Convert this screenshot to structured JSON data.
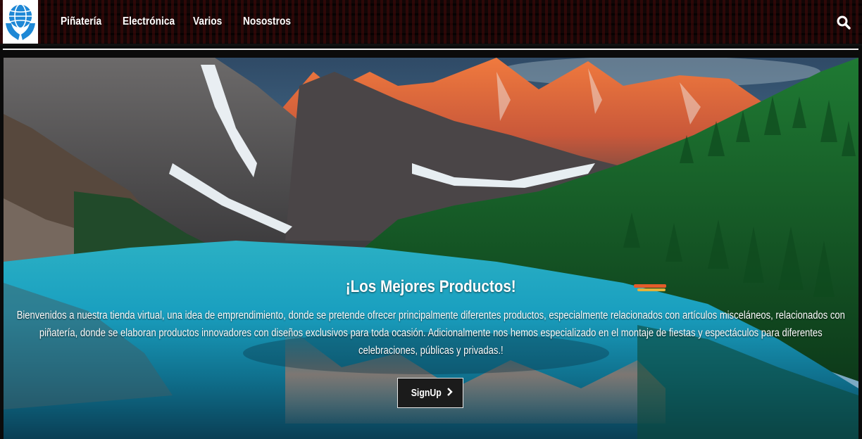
{
  "nav": {
    "logo_icon": "globe-hands-logo",
    "links": [
      "Piñatería",
      "Electrónica",
      "Varios",
      "Nosostros"
    ],
    "search_icon": "search-icon"
  },
  "hero": {
    "background": "mountain-lake-landscape",
    "title": "¡Los Mejores Productos!",
    "description": "Bienvenidos a nuestra tienda virtual, una idea de emprendimiento, donde se pretende ofrecer principalmente diferentes productos, especialmente relacionados con artículos misceláneos, relacionados con piñatería, donde se elaboran productos innovadores con diseños exclusivos para toda ocasión. Adicionalmente nos hemos especializado en el montaje de fiestas y espectáculos para diferentes celebraciones, públicas y privadas.!",
    "button_label": "SignUp",
    "button_icon": "chevron-right-icon"
  },
  "colors": {
    "navbar": "#120606",
    "logo_blue": "#1e88d6",
    "button_bg": "#1b1b1b"
  }
}
